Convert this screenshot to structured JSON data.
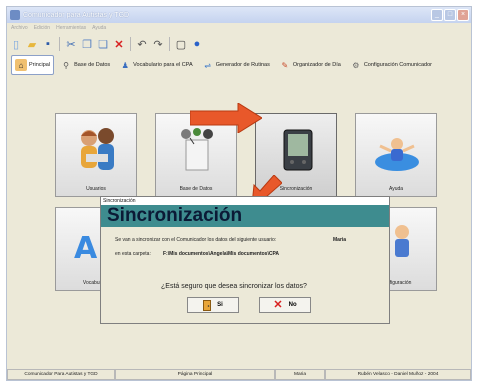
{
  "window": {
    "title": "Comunicador para Autistas y TGD"
  },
  "menubar": [
    "Archivo",
    "Edición",
    "Herramientas",
    "Ayuda"
  ],
  "toolbar": {
    "icons": [
      "new-icon",
      "open-folder-icon",
      "save-icon",
      "cut-icon",
      "copy-icon",
      "paste-icon",
      "delete-icon",
      "undo-icon",
      "redo-icon",
      "page-icon",
      "help-icon"
    ]
  },
  "tabs": [
    {
      "label": "Principal",
      "icon": "home-icon"
    },
    {
      "label": "Base de Datos",
      "icon": "database-icon"
    },
    {
      "label": "Vocabulario para el CPA",
      "icon": "vocabulary-icon"
    },
    {
      "label": "Generador de Rutinas",
      "icon": "routine-icon"
    },
    {
      "label": "Organizador de Día",
      "icon": "organizer-icon"
    },
    {
      "label": "Configuración Comunicador",
      "icon": "config-icon"
    }
  ],
  "tiles": [
    {
      "label": "Usuarios"
    },
    {
      "label": "Base de Datos"
    },
    {
      "label": "Sincronización"
    },
    {
      "label": "Ayuda"
    },
    {
      "label": "Vocabulario"
    },
    {
      "label": "Configuración"
    }
  ],
  "dialog": {
    "window_title": "Sincronización",
    "banner": "Sincronización",
    "line1_text": "Se van a sincronizar con el Comunicador los datos del siguiente usuario:",
    "line1_value": "Maria",
    "line2_text": "en esta carpeta:",
    "line2_value": "F:\\Mis documentos\\Angela\\Mis documentos\\CPA",
    "question": "¿Está seguro que desea sincronizar los datos?",
    "yes_label": "Si",
    "no_label": "No"
  },
  "status": {
    "app": "Comunicador Para Autistas y TGD",
    "page": "Página Principal",
    "user": "Maria",
    "authors": "Rubén Velasco - Daniel Muñoz - 2004"
  },
  "colors": {
    "banner_bg": "#3e8c8f",
    "banner_text": "#0b1a36",
    "arrow": "#e8582a"
  }
}
